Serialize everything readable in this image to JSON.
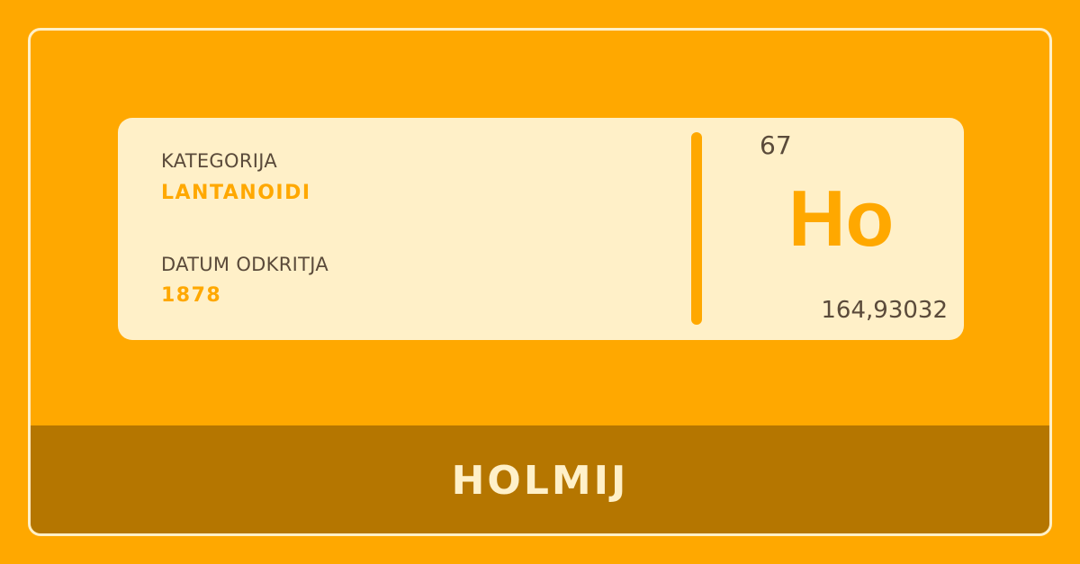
{
  "card": {
    "category_label": "KATEGORIJA",
    "category_value": "LANTANOIDI",
    "discovery_label": "DATUM ODKRITJA",
    "discovery_value": "1878",
    "atomic_number": "67",
    "symbol": "Ho",
    "atomic_mass": "164,93032"
  },
  "footer": {
    "element_name": "HOLMIJ"
  },
  "colors": {
    "background": "#FFA800",
    "card": "#FFF0C8",
    "footer": "#B57600",
    "text_dark": "#5a4a3a"
  }
}
